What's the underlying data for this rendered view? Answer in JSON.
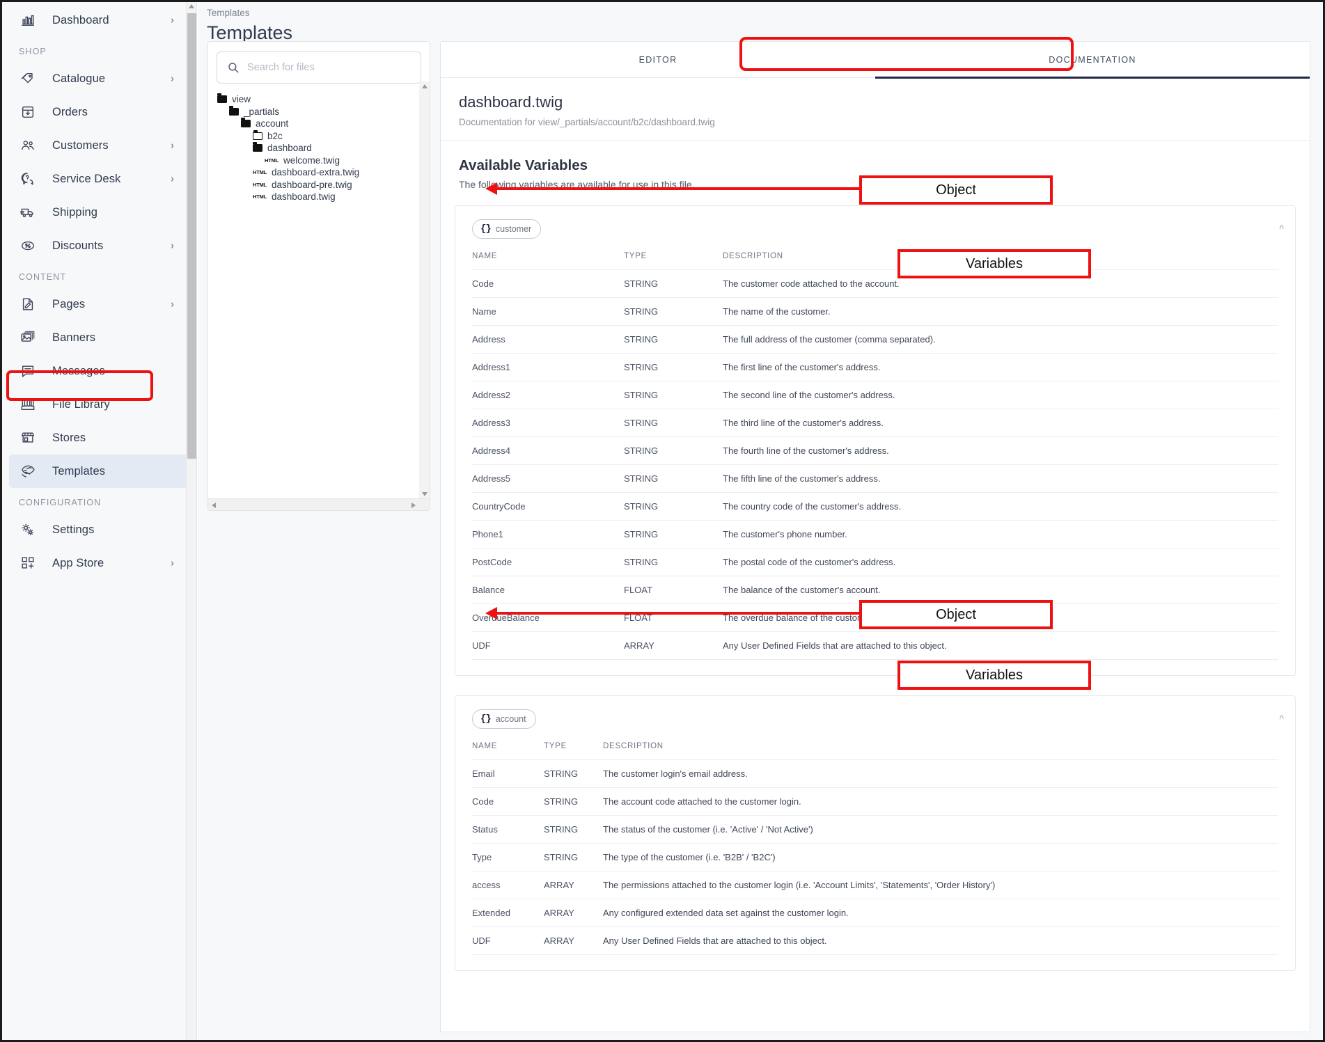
{
  "sidebar": {
    "items": [
      {
        "label": "Dashboard",
        "icon": "dashboard-chart-icon",
        "chevron": true,
        "section": null,
        "active": false
      },
      {
        "label": "Catalogue",
        "icon": "tag-icon",
        "chevron": true,
        "section": "SHOP",
        "active": false
      },
      {
        "label": "Orders",
        "icon": "box-arrow-down-icon",
        "chevron": false,
        "section": null,
        "active": false
      },
      {
        "label": "Customers",
        "icon": "people-icon",
        "chevron": true,
        "section": null,
        "active": false
      },
      {
        "label": "Service Desk",
        "icon": "question-chat-icon",
        "chevron": true,
        "section": null,
        "active": false
      },
      {
        "label": "Shipping",
        "icon": "truck-icon",
        "chevron": false,
        "section": null,
        "active": false
      },
      {
        "label": "Discounts",
        "icon": "percent-tag-icon",
        "chevron": true,
        "section": null,
        "active": false
      },
      {
        "label": "Pages",
        "icon": "page-edit-icon",
        "chevron": true,
        "section": "CONTENT",
        "active": false
      },
      {
        "label": "Banners",
        "icon": "images-icon",
        "chevron": false,
        "section": null,
        "active": false
      },
      {
        "label": "Messages",
        "icon": "message-icon",
        "chevron": false,
        "section": null,
        "active": false
      },
      {
        "label": "File Library",
        "icon": "library-icon",
        "chevron": false,
        "section": null,
        "active": false
      },
      {
        "label": "Stores",
        "icon": "storefront-icon",
        "chevron": false,
        "section": null,
        "active": false
      },
      {
        "label": "Templates",
        "icon": "templates-icon",
        "chevron": false,
        "section": null,
        "active": true
      },
      {
        "label": "Settings",
        "icon": "gears-icon",
        "chevron": false,
        "section": "CONFIGURATION",
        "active": false
      },
      {
        "label": "App Store",
        "icon": "app-grid-plus-icon",
        "chevron": true,
        "section": null,
        "active": false
      }
    ],
    "sections": {
      "shop": "SHOP",
      "content": "CONTENT",
      "configuration": "CONFIGURATION"
    }
  },
  "header": {
    "breadcrumb": "Templates",
    "page_title": "Templates"
  },
  "file_browser": {
    "search_placeholder": "Search for files",
    "search_value": "",
    "tree": [
      {
        "label": "view",
        "type": "folder",
        "depth": 0
      },
      {
        "label": "_partials",
        "type": "folder",
        "depth": 1
      },
      {
        "label": "account",
        "type": "folder",
        "depth": 2
      },
      {
        "label": "b2c",
        "type": "folder-open",
        "depth": 3
      },
      {
        "label": "dashboard",
        "type": "folder",
        "depth": 3
      },
      {
        "label": "welcome.twig",
        "type": "file",
        "depth": 4,
        "badge": "HTML"
      },
      {
        "label": "dashboard-extra.twig",
        "type": "file",
        "depth": 3,
        "badge": "HTML"
      },
      {
        "label": "dashboard-pre.twig",
        "type": "file",
        "depth": 3,
        "badge": "HTML"
      },
      {
        "label": "dashboard.twig",
        "type": "file",
        "depth": 3,
        "badge": "HTML"
      }
    ]
  },
  "tabs": [
    {
      "label": "EDITOR",
      "active": false
    },
    {
      "label": "DOCUMENTATION",
      "active": true
    }
  ],
  "documentation": {
    "title": "dashboard.twig",
    "subtitle": "Documentation for view/_partials/account/b2c/dashboard.twig",
    "section_title": "Available Variables",
    "section_desc": "The following variables are available for use in this file.",
    "columns": {
      "name": "NAME",
      "type": "TYPE",
      "description": "DESCRIPTION"
    },
    "objects": [
      {
        "name": "customer",
        "rows": [
          {
            "name": "Code",
            "type": "STRING",
            "description": "The customer code attached to the account."
          },
          {
            "name": "Name",
            "type": "STRING",
            "description": "The name of the customer."
          },
          {
            "name": "Address",
            "type": "STRING",
            "description": "The full address of the customer (comma separated)."
          },
          {
            "name": "Address1",
            "type": "STRING",
            "description": "The first line of the customer's address."
          },
          {
            "name": "Address2",
            "type": "STRING",
            "description": "The second line of the customer's address."
          },
          {
            "name": "Address3",
            "type": "STRING",
            "description": "The third line of the customer's address."
          },
          {
            "name": "Address4",
            "type": "STRING",
            "description": "The fourth line of the customer's address."
          },
          {
            "name": "Address5",
            "type": "STRING",
            "description": "The fifth line of the customer's address."
          },
          {
            "name": "CountryCode",
            "type": "STRING",
            "description": "The country code of the customer's address."
          },
          {
            "name": "Phone1",
            "type": "STRING",
            "description": "The customer's phone number."
          },
          {
            "name": "PostCode",
            "type": "STRING",
            "description": "The postal code of the customer's address."
          },
          {
            "name": "Balance",
            "type": "FLOAT",
            "description": "The balance of the customer's account."
          },
          {
            "name": "OverdueBalance",
            "type": "FLOAT",
            "description": "The overdue balance of the customer's account."
          },
          {
            "name": "UDF",
            "type": "ARRAY",
            "description": "Any User Defined Fields that are attached to this object."
          }
        ]
      },
      {
        "name": "account",
        "rows": [
          {
            "name": "Email",
            "type": "STRING",
            "description": "The customer login's email address."
          },
          {
            "name": "Code",
            "type": "STRING",
            "description": "The account code attached to the customer login."
          },
          {
            "name": "Status",
            "type": "STRING",
            "description": "The status of the customer (i.e. 'Active' / 'Not Active')"
          },
          {
            "name": "Type",
            "type": "STRING",
            "description": "The type of the customer (i.e. 'B2B' / 'B2C')"
          },
          {
            "name": "access",
            "type": "ARRAY",
            "description": "The permissions attached to the customer login (i.e. 'Account Limits', 'Statements', 'Order History')"
          },
          {
            "name": "Extended",
            "type": "ARRAY",
            "description": "Any configured extended data set against the customer login."
          },
          {
            "name": "UDF",
            "type": "ARRAY",
            "description": "Any User Defined Fields that are attached to this object."
          }
        ]
      }
    ]
  },
  "annotations": {
    "color": "#ee1111",
    "callouts": [
      {
        "label": "Object",
        "target": "customer-object-chip"
      },
      {
        "label": "Variables",
        "target": "customer-variables-table"
      },
      {
        "label": "Object",
        "target": "account-object-chip"
      },
      {
        "label": "Variables",
        "target": "account-variables-table"
      }
    ],
    "highlights": [
      {
        "target": "sidebar-item-templates"
      },
      {
        "target": "tab-documentation"
      }
    ]
  }
}
